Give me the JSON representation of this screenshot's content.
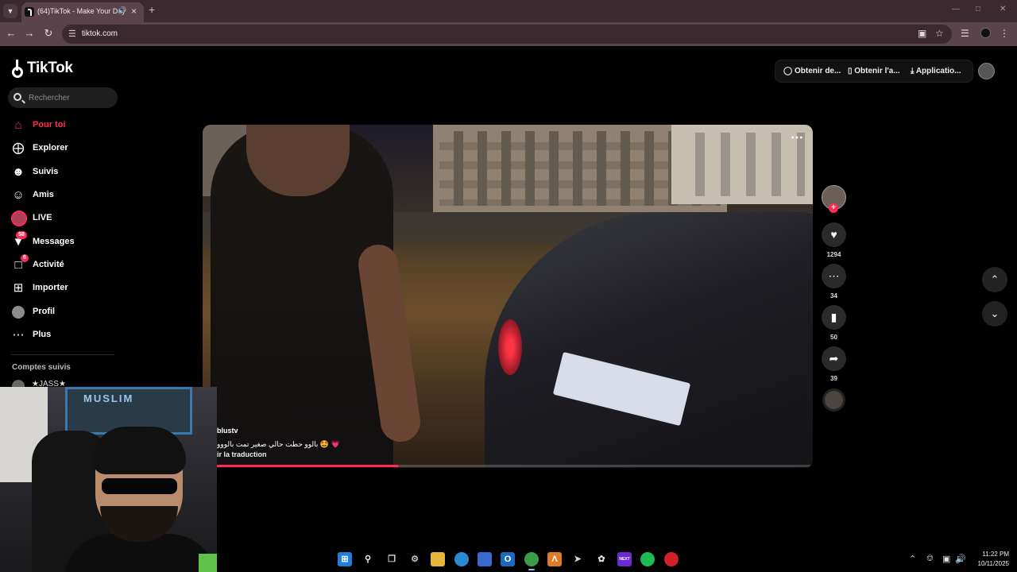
{
  "browser": {
    "tab_title": "(64)TikTok - Make Your Day",
    "tab_audio_icon": "speaker-icon",
    "url": "tiktok.com"
  },
  "tiktok": {
    "logo": "TikTok",
    "search_placeholder": "Rechercher",
    "nav": [
      {
        "label": "Pour toi",
        "icon": "home-icon",
        "active": true
      },
      {
        "label": "Explorer",
        "icon": "compass-icon"
      },
      {
        "label": "Suivis",
        "icon": "following-icon"
      },
      {
        "label": "Amis",
        "icon": "friends-icon"
      },
      {
        "label": "LIVE",
        "icon": "live-icon"
      },
      {
        "label": "Messages",
        "icon": "messages-icon",
        "badge": "58"
      },
      {
        "label": "Activité",
        "icon": "activity-icon",
        "badge": "6"
      },
      {
        "label": "Importer",
        "icon": "upload-icon"
      },
      {
        "label": "Profil",
        "icon": "profile-avatar"
      },
      {
        "label": "Plus",
        "icon": "more-icon"
      }
    ],
    "followed_title": "Comptes suivis",
    "followed_first": "★JASS★",
    "top_actions": {
      "coins": "Obtenir de...",
      "app": "Obtenir l'a...",
      "download": "Applicatio..."
    },
    "video": {
      "author": "blustv",
      "caption": "بالوو حطت حالي صغير تمت بالووو",
      "caption_emoji": "🤩 💗",
      "translate": "ir la traduction",
      "progress": 0.32
    },
    "actions": {
      "likes": "1294",
      "comments": "34",
      "saves": "50",
      "shares": "39"
    }
  },
  "webcam": {
    "sign_text": "MUSLIM"
  },
  "taskbar": {
    "time": "11:22 PM",
    "date": "10/11/2025",
    "next_label": "NEXT"
  }
}
